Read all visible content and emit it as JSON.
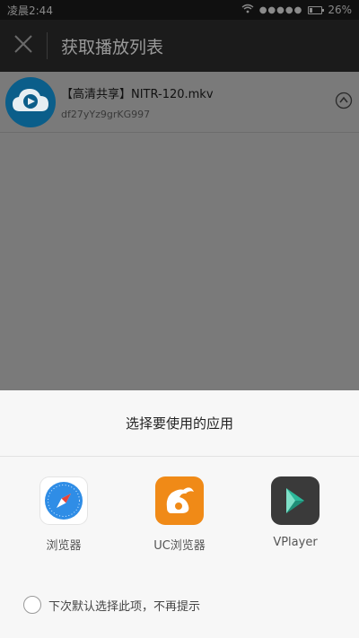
{
  "status_bar": {
    "time": "凌晨2:44",
    "signal_dots": "●●●●●",
    "battery_level": 0.26,
    "battery_text": "26%",
    "wifi_icon": "wifi-icon"
  },
  "header": {
    "title": "获取播放列表",
    "close_icon": "close-icon"
  },
  "file": {
    "name": "【高清共享】NITR-120.mkv",
    "id": "df27yYz9grKG997",
    "icon": "cloud-play-icon",
    "expand_icon": "expand-up-icon"
  },
  "chooser": {
    "title": "选择要使用的应用",
    "apps": [
      {
        "label": "浏览器",
        "icon": "safari-compass-icon"
      },
      {
        "label": "UC浏览器",
        "icon": "uc-squirrel-icon"
      },
      {
        "label": "VPlayer",
        "icon": "vplayer-icon"
      }
    ],
    "default_label": "下次默认选择此项，不再提示"
  },
  "colors": {
    "overlay": "#7a7a7a",
    "title_bar": "#1b1b1b",
    "uc_orange": "#f08a17",
    "vplayer_teal": "#2bb89a",
    "safari_blue": "#2f8de6"
  }
}
